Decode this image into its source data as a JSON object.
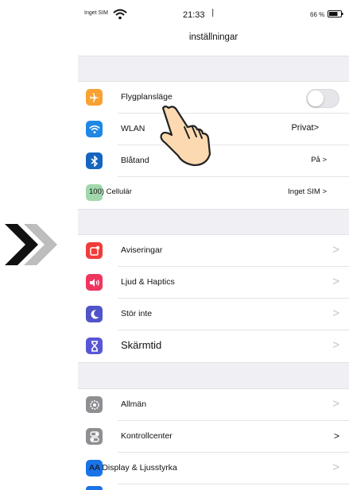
{
  "status_bar": {
    "carrier": "Inget SIM",
    "time": "21:33",
    "extra": "ꟾ",
    "battery_percent": "66 %"
  },
  "header": {
    "title": "inställningar"
  },
  "groups": [
    {
      "rows": [
        {
          "label": "Flygplansläge",
          "icon": "airplane-icon",
          "icon_color": "#f7a233",
          "accessory": "toggle",
          "toggle_on": false
        },
        {
          "label": "WLAN",
          "icon": "wifi-icon",
          "icon_color": "#1e88e5",
          "value": "Privat>"
        },
        {
          "label": "Blåtand",
          "icon": "bluetooth-icon",
          "icon_color": "#1565c0",
          "value": "På >"
        },
        {
          "label": "100) Cellulär",
          "icon": "cellular-icon",
          "icon_color": "#8fd19e",
          "value": "Inget SIM >"
        }
      ]
    },
    {
      "rows": [
        {
          "label": "Aviseringar",
          "icon": "notifications-icon",
          "icon_color": "#f23b3b",
          "chevron": ">"
        },
        {
          "label": "Ljud & Haptics",
          "icon": "sound-icon",
          "icon_color": "#f0355e",
          "chevron": ">"
        },
        {
          "label": "Stör inte",
          "icon": "moon-icon",
          "icon_color": "#4f54c8",
          "chevron": ">"
        },
        {
          "label": "Skärmtid",
          "icon": "hourglass-icon",
          "icon_color": "#5856d6",
          "chevron": ">"
        }
      ]
    },
    {
      "rows": [
        {
          "label": "Allmän",
          "icon": "gear-icon",
          "icon_color": "#8e8e93",
          "chevron": ">"
        },
        {
          "label": "Kontrollcenter",
          "icon": "control-center-icon",
          "icon_color": "#8e8e93",
          "chevron": ">"
        },
        {
          "label": "AA Display & Ljusstyrka",
          "icon": "display-icon",
          "icon_color": "#1a73e8",
          "chevron": ">"
        }
      ]
    }
  ]
}
